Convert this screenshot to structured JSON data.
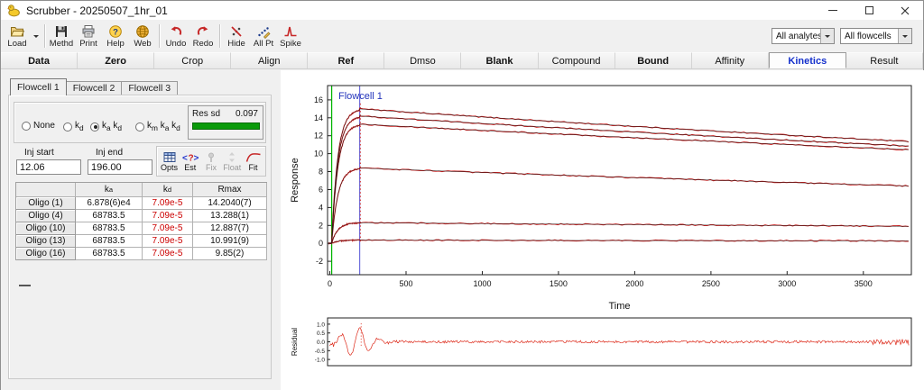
{
  "window": {
    "title": "Scrubber - 20250507_1hr_01"
  },
  "toolbar": {
    "items": [
      {
        "type": "button",
        "id": "load",
        "label": "Load",
        "icon": "folder-open-icon",
        "dropdown": true
      },
      {
        "type": "separator"
      },
      {
        "type": "button",
        "id": "methd",
        "label": "Methd",
        "icon": "save-icon"
      },
      {
        "type": "button",
        "id": "print",
        "label": "Print",
        "icon": "printer-icon"
      },
      {
        "type": "button",
        "id": "help",
        "label": "Help",
        "icon": "help-icon"
      },
      {
        "type": "button",
        "id": "web",
        "label": "Web",
        "icon": "globe-icon"
      },
      {
        "type": "separator"
      },
      {
        "type": "button",
        "id": "undo",
        "label": "Undo",
        "icon": "undo-icon"
      },
      {
        "type": "button",
        "id": "redo",
        "label": "Redo",
        "icon": "redo-icon"
      },
      {
        "type": "separator"
      },
      {
        "type": "button",
        "id": "hide",
        "label": "Hide",
        "icon": "hide-icon"
      },
      {
        "type": "button",
        "id": "allpt",
        "label": "All Pt",
        "icon": "all-points-icon"
      },
      {
        "type": "button",
        "id": "spike",
        "label": "Spike",
        "icon": "spike-icon"
      }
    ],
    "analytes_filter": "All analytes",
    "flowcells_filter": "All flowcells"
  },
  "main_tabs": [
    {
      "label": "Data",
      "bold": true
    },
    {
      "label": "Zero",
      "bold": true
    },
    {
      "label": "Crop",
      "bold": false
    },
    {
      "label": "Align",
      "bold": false
    },
    {
      "label": "Ref",
      "bold": true
    },
    {
      "label": "Dmso",
      "bold": false
    },
    {
      "label": "Blank",
      "bold": true
    },
    {
      "label": "Compound",
      "bold": false
    },
    {
      "label": "Bound",
      "bold": true
    },
    {
      "label": "Affinity",
      "bold": false
    },
    {
      "label": "Kinetics",
      "bold": true,
      "active": true
    },
    {
      "label": "Result",
      "bold": false
    }
  ],
  "accent_color": "#1430cc",
  "panel": {
    "flowcell_tabs": [
      {
        "label": "Flowcell 1",
        "active": true
      },
      {
        "label": "Flowcell 2",
        "active": false
      },
      {
        "label": "Flowcell 3",
        "active": false
      }
    ],
    "model_options": [
      {
        "label": "None",
        "selected": false
      },
      {
        "label": "kd",
        "selected": false
      },
      {
        "label": "ka kd",
        "selected": true
      },
      {
        "label": "km ka kd",
        "selected": false
      }
    ],
    "res_sd": {
      "label": "Res sd",
      "value": "0.097",
      "bar_color": "#0a9a0a"
    },
    "inj_start_label": "Inj start",
    "inj_start_value": "12.06",
    "inj_end_label": "Inj end",
    "inj_end_value": "196.00",
    "fit_buttons": [
      {
        "label": "Opts",
        "icon": "options-grid-icon",
        "disabled": false
      },
      {
        "label": "Est",
        "icon": "estimate-icon",
        "disabled": false
      },
      {
        "label": "Fix",
        "icon": "fix-icon",
        "disabled": true
      },
      {
        "label": "Float",
        "icon": "float-icon",
        "disabled": true
      },
      {
        "label": "Fit",
        "icon": "fit-curve-icon",
        "disabled": false
      }
    ],
    "table": {
      "headers": [
        "",
        "ka",
        "kd",
        "Rmax"
      ],
      "kd_color": "#cc0000",
      "rows": [
        {
          "label": "Oligo (1)",
          "ka": "6.878(6)e4",
          "kd": "7.09e-5",
          "rmax": "14.2040(7)"
        },
        {
          "label": "Oligo (4)",
          "ka": "68783.5",
          "kd": "7.09e-5",
          "rmax": "13.288(1)"
        },
        {
          "label": "Oligo (10)",
          "ka": "68783.5",
          "kd": "7.09e-5",
          "rmax": "12.887(7)"
        },
        {
          "label": "Oligo (13)",
          "ka": "68783.5",
          "kd": "7.09e-5",
          "rmax": "10.991(9)"
        },
        {
          "label": "Oligo (16)",
          "ka": "68783.5",
          "kd": "7.09e-5",
          "rmax": "9.85(2)"
        }
      ]
    }
  },
  "chart_data": {
    "main": {
      "type": "line",
      "annotation": "Flowcell 1",
      "annotation_color": "#2233bb",
      "xlabel": "Time",
      "ylabel": "Response",
      "xlim": [
        -15,
        3815
      ],
      "ylim": [
        -3.5,
        17.6
      ],
      "xticks": [
        0,
        500,
        1000,
        1500,
        2000,
        2500,
        3000,
        3500
      ],
      "yticks": [
        -2,
        0,
        2,
        4,
        6,
        8,
        10,
        12,
        14,
        16
      ],
      "injection_start_x": 12.06,
      "injection_start_color": "#00b400",
      "injection_end_x": 196,
      "injection_end_color": "#7070dd",
      "association_tau": 40,
      "t_end": 3800,
      "data_color": "#cc1f1f",
      "fit_color": "#1a1a1a",
      "artifact_x": 200,
      "artifact_range": [
        0,
        15.6
      ],
      "series": [
        {
          "name": "Oligo (1)",
          "peak": 15.0,
          "end": 11.35
        },
        {
          "name": "Oligo (4)",
          "peak": 14.2,
          "end": 10.85
        },
        {
          "name": "Oligo (10)",
          "peak": 13.3,
          "end": 10.45
        },
        {
          "name": "Oligo (13)",
          "peak": 8.4,
          "end": 6.4
        },
        {
          "name": "Oligo (16)",
          "peak": 2.3,
          "end": 1.9
        },
        {
          "name": "blank",
          "peak": 0.35,
          "end": 0.28
        }
      ]
    },
    "residual": {
      "type": "line",
      "ylabel": "Residual",
      "xlim": [
        -15,
        3815
      ],
      "ylim": [
        -1.35,
        1.35
      ],
      "yticks": [
        1.0,
        0.5,
        0.0,
        -0.5,
        -1.0
      ],
      "color": "#dd2a1a",
      "noise_amplitude": 0.07,
      "spike_center": 170,
      "spike_amplitude": 0.8,
      "artifact_x": 205,
      "artifact_range": [
        -0.25,
        1.05
      ]
    }
  }
}
